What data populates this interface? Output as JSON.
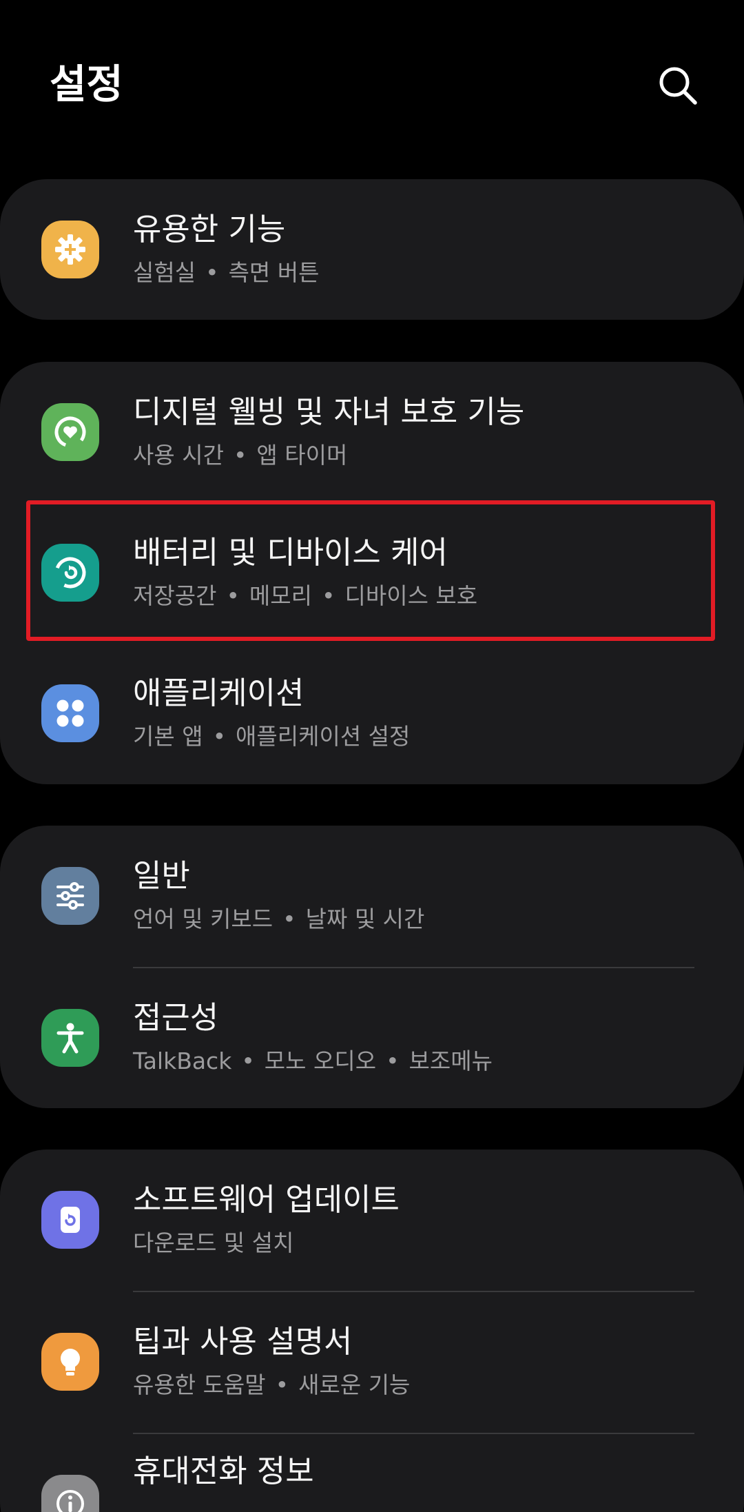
{
  "header": {
    "title": "설정",
    "search_icon": "search-icon"
  },
  "items": {
    "advanced": {
      "title": "유용한 기능",
      "sub": [
        "실험실",
        "측면 버튼"
      ],
      "icon": "gear-plus-icon",
      "color": "#f0b34a"
    },
    "wellbeing": {
      "title": "디지털 웰빙 및 자녀 보호 기능",
      "sub": [
        "사용 시간",
        "앱 타이머"
      ],
      "icon": "wellbeing-heart-icon",
      "color": "#5fb35a"
    },
    "battery": {
      "title": "배터리 및 디바이스 케어",
      "sub": [
        "저장공간",
        "메모리",
        "디바이스 보호"
      ],
      "icon": "device-care-icon",
      "color": "#159e8d"
    },
    "apps": {
      "title": "애플리케이션",
      "sub": [
        "기본 앱",
        "애플리케이션 설정"
      ],
      "icon": "apps-grid-icon",
      "color": "#5b8fe0"
    },
    "general": {
      "title": "일반",
      "sub": [
        "언어 및 키보드",
        "날짜 및 시간"
      ],
      "icon": "sliders-icon",
      "color": "#627f9e"
    },
    "accessibility": {
      "title": "접근성",
      "sub": [
        "TalkBack",
        "모노 오디오",
        "보조메뉴"
      ],
      "icon": "accessibility-person-icon",
      "color": "#2f9c57"
    },
    "update": {
      "title": "소프트웨어 업데이트",
      "sub": [
        "다운로드 및 설치"
      ],
      "icon": "software-update-icon",
      "color": "#6f72e6"
    },
    "tips": {
      "title": "팁과 사용 설명서",
      "sub": [
        "유용한 도움말",
        "새로운 기능"
      ],
      "icon": "lightbulb-icon",
      "color": "#ef9a3e"
    },
    "about": {
      "title": "휴대전화 정보",
      "icon": "info-icon",
      "color": "#8a8a8c"
    }
  },
  "separator": "•",
  "highlight_color": "#e21c25"
}
